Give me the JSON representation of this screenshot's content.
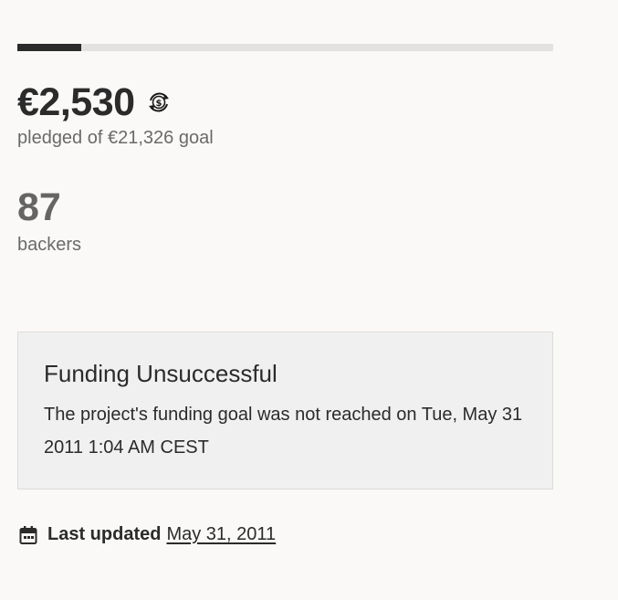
{
  "funding": {
    "progress_fraction": 0.1186,
    "pledged_amount": "€2,530",
    "pledged_caption": "pledged of €21,326 goal",
    "currency_icon": "currency-convert-icon",
    "backers_count": "87",
    "backers_caption": "backers"
  },
  "status": {
    "title": "Funding Unsuccessful",
    "message": "The project's funding goal was not reached on Tue, May 31 2011 1:04 AM CEST"
  },
  "updated": {
    "icon": "calendar-icon",
    "label": "Last updated",
    "date": "May 31, 2011"
  },
  "colors": {
    "progress_fill": "#2b2b2b",
    "progress_track": "#e3e2e0",
    "status_bg": "#f0f0f0"
  }
}
